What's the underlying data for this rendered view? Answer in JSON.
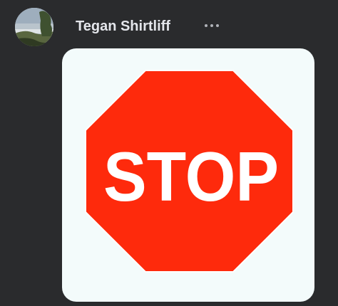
{
  "post": {
    "author_name": "Tegan Shirtliff",
    "avatar_icon": "user-avatar-landscape",
    "more_icon": "more-horizontal-icon"
  },
  "image": {
    "sign_text": "STOP",
    "sign_color": "#fe2a0c",
    "text_color": "#ffffff",
    "background_color": "#f3fbfb"
  },
  "theme": {
    "background": "#2a2b2d",
    "name_color": "#e4e6eb",
    "icon_color": "#b0b3b8"
  }
}
